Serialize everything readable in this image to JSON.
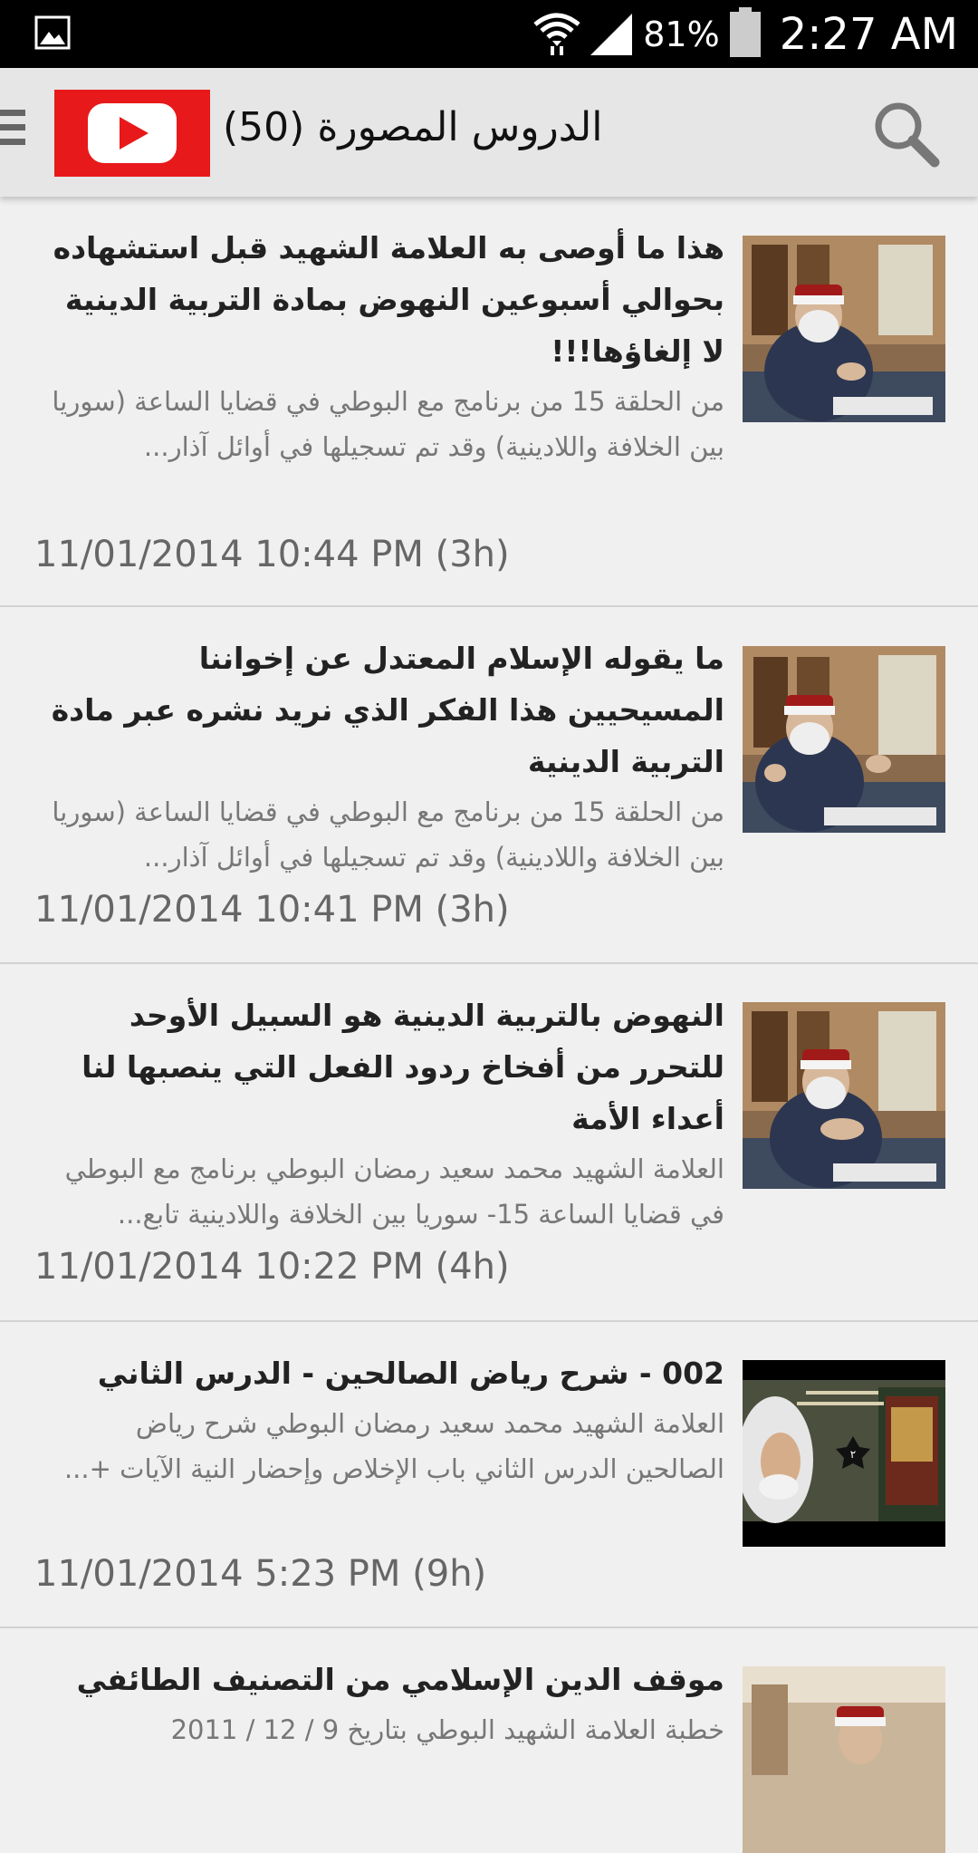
{
  "status_bar": {
    "battery": "81%",
    "time": "2:27 AM"
  },
  "action_bar": {
    "title": "الدروس المصورة (50)"
  },
  "items": [
    {
      "title": "هذا ما أوصى به العلامة الشهيد قبل استشهاده بحوالي أسبوعين النهوض بمادة التربية الدينية لا إلغاؤها!!!",
      "description": "من الحلقة 15 من برنامج مع البوطي في قضايا الساعة (سوريا بين الخلافة واللادينية) وقد تم تسجيلها في أوائل آذار...",
      "date": "11/01/2014 10:44 PM (3h)"
    },
    {
      "title": "ما يقوله الإسلام المعتدل عن إخواننا المسيحيين هذا الفكر الذي نريد نشره عبر مادة التربية الدينية",
      "description": "من الحلقة 15 من برنامج مع البوطي في قضايا الساعة (سوريا بين الخلافة واللادينية) وقد تم تسجيلها في أوائل آذار...",
      "date": "11/01/2014 10:41 PM (3h)"
    },
    {
      "title": "النهوض بالتربية الدينية هو السبيل الأوحد للتحرر من أفخاخ ردود الفعل التي ينصبها لنا أعداء الأمة",
      "description": "العلامة الشهيد محمد سعيد رمضان البوطي برنامج مع البوطي في قضايا الساعة 15- سوريا بين الخلافة واللادينية تابع...",
      "date": "11/01/2014 10:22 PM (4h)"
    },
    {
      "title": "002 - شرح رياض الصالحين - الدرس الثاني",
      "description": "العلامة الشهيد محمد سعيد رمضان البوطي شرح رياض الصالحين الدرس الثاني باب الإخلاص وإحضار النية الآيات +...",
      "date": "11/01/2014 5:23 PM (9h)"
    },
    {
      "title": "موقف الدين الإسلامي من التصنيف الطائفي",
      "description": "خطبة العلامة الشهيد البوطي بتاريخ 9 / 12 / 2011",
      "date": ""
    }
  ]
}
